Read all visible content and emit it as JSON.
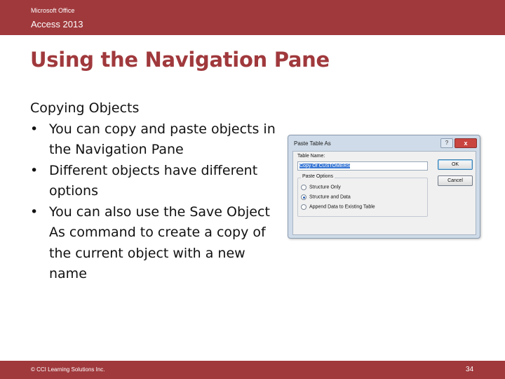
{
  "header": {
    "brand_line1": "Microsoft Office",
    "brand_line2": "Access 2013"
  },
  "slide": {
    "title": "Using the Navigation Pane",
    "section_heading": "Copying Objects",
    "bullets": [
      "You can copy and paste objects in the Navigation Pane",
      "Different objects have different options",
      "You can also use the Save Object As command to create a copy of the current object with a new name"
    ],
    "bullet_mark": "•"
  },
  "dialog": {
    "title": "Paste Table As",
    "help_label": "?",
    "close_label": "x",
    "table_name_label": "Table Name:",
    "table_name_value": "Copy Of CUSTOMERS",
    "paste_options_label": "Paste Options",
    "options": [
      {
        "label": "Structure Only",
        "checked": false
      },
      {
        "label": "Structure and Data",
        "checked": true
      },
      {
        "label": "Append Data to Existing Table",
        "checked": false
      }
    ],
    "ok_label": "OK",
    "cancel_label": "Cancel"
  },
  "footer": {
    "copyright": "© CCI Learning Solutions Inc.",
    "page_number": "34"
  },
  "colors": {
    "accent": "#a0393c",
    "dialog_frame": "#cfdbe8",
    "selection": "#3a78d4"
  }
}
